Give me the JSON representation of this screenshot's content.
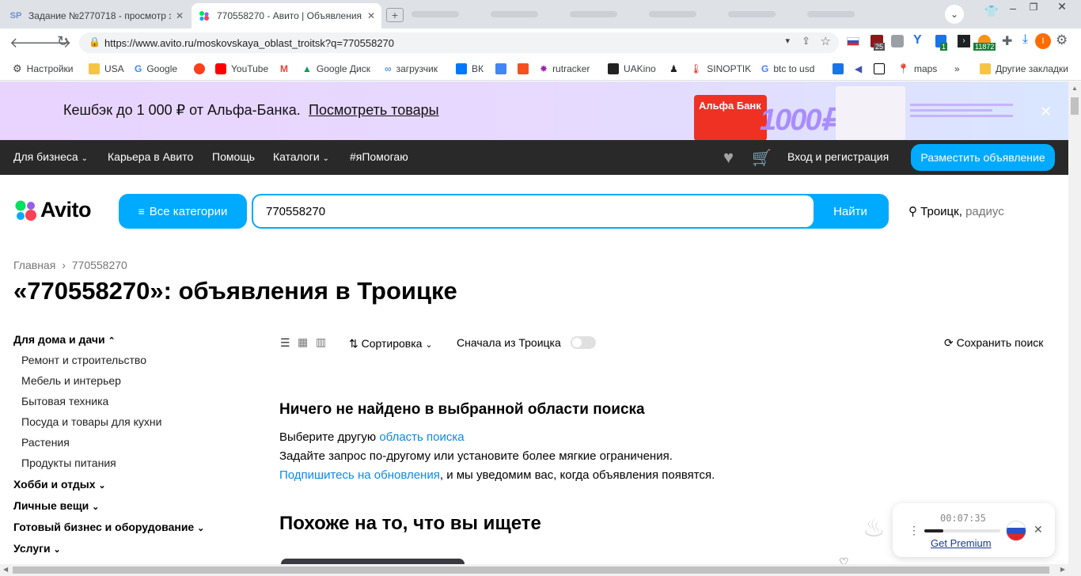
{
  "browser": {
    "tabs": [
      {
        "label": "Задание №2770718 - просмотр з",
        "icon": "sp-icon"
      },
      {
        "label": "770558270 - Авито | Объявления",
        "icon": "avito-icon"
      }
    ],
    "url": "https://www.avito.ru/moskovskaya_oblast_troitsk?q=770558270",
    "ext_badges": {
      "badge1": "25",
      "badge2": "1",
      "badge3": "11872"
    },
    "profile_initial": "I"
  },
  "bookmarks": {
    "items": [
      "Настройки",
      "USA",
      "Google",
      "YouTube",
      "Google Диск",
      "загрузчик",
      "ВК",
      "rutracker",
      "UAKino",
      "SINOPTIK",
      "btc to usd",
      "maps"
    ],
    "other": "Другие закладки",
    "more": "»"
  },
  "banner": {
    "text": "Кешбэк до 1 000 ₽ от Альфа-Банка.",
    "link": "Посмотреть товары",
    "bank": "Альфа Банк",
    "amount": "1000₽"
  },
  "nav": {
    "business": "Для бизнеса",
    "career": "Карьера в Авито",
    "help": "Помощь",
    "catalogs": "Каталоги",
    "help_tag": "#яПомогаю",
    "login": "Вход и регистрация",
    "post_ad": "Разместить объявление"
  },
  "header": {
    "logo": "Avito",
    "all_categories": "Все категории",
    "search_value": "770558270",
    "search_button": "Найти",
    "city": "Троицк,",
    "radius": "радиус"
  },
  "breadcrumb": {
    "home": "Главная",
    "sep": "›",
    "current": "770558270"
  },
  "page_title": "«770558270»: объявления в Троицке",
  "sidebar": {
    "groups": [
      {
        "title": "Для дома и дачи",
        "items": [
          "Ремонт и строительство",
          "Мебель и интерьер",
          "Бытовая техника",
          "Посуда и товары для кухни",
          "Растения",
          "Продукты питания"
        ]
      },
      {
        "title": "Хобби и отдых",
        "items": []
      },
      {
        "title": "Личные вещи",
        "items": []
      },
      {
        "title": "Готовый бизнес и оборудование",
        "items": []
      },
      {
        "title": "Услуги",
        "items": []
      }
    ]
  },
  "toolbar": {
    "sort": "Сортировка",
    "first_from": "Сначала из Троицка",
    "save_search": "Сохранить поиск"
  },
  "empty": {
    "heading": "Ничего не найдено в выбранной области поиска",
    "line1_prefix": "Выберите другую ",
    "line1_link": "область поиска",
    "line2": "Задайте запрос по-другому или установите более мягкие ограничения.",
    "line3_link": "Подпишитесь на обновления",
    "line3_suffix": ", и мы уведомим вас, когда объявления появятся."
  },
  "similar_heading": "Похоже на то, что вы ищете",
  "vpn_widget": {
    "timer": "00:07:35",
    "premium": "Get Premium",
    "progress": 0.25
  },
  "colors": {
    "accent": "#00aaff",
    "link": "#0a8ae6",
    "nav_bg": "#292929",
    "alfa_red": "#ef3124"
  }
}
